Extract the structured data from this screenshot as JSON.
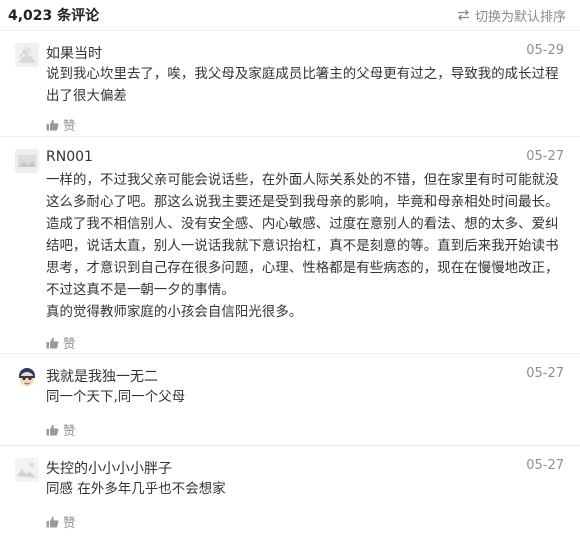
{
  "header": {
    "count_label": "4,023 条评论",
    "sort_label": "切换为默认排序"
  },
  "comments": [
    {
      "user": "如果当时",
      "date": "05-29",
      "lines": [
        "说到我心坎里去了，唉，我父母及家庭成员比箸主的父母更有过之，导致我的成长过程",
        "出了很大偏差"
      ],
      "like_label": "赞"
    },
    {
      "user": "RN001",
      "date": "05-27",
      "lines": [
        "一样的，不过我父亲可能会说话些，在外面人际关系处的不错，但在家里有时可能就没",
        "这么多耐心了吧。那这么说我主要还是受到我母亲的影响，毕竟和母亲相处时间最长。",
        "造成了我不相信别人、没有安全感、内心敏感、过度在意别人的看法、想的太多、爱纠",
        "结吧，说话太直，别人一说话我就下意识抬杠，真不是刻意的等。直到后来我开始读书",
        "思考，才意识到自己存在很多问题，心理、性格都是有些病态的，现在在慢慢地改正，",
        "不过这真不是一朝一夕的事情。",
        "真的觉得教师家庭的小孩会自信阳光很多。"
      ],
      "like_label": "赞"
    },
    {
      "user": "我就是我独一无二",
      "date": "05-27",
      "lines": [
        "同一个天下,同一个父母"
      ],
      "like_label": "赞"
    },
    {
      "user": "失控的小小小小胖子",
      "date": "05-27",
      "lines": [
        "同感 在外多年几乎也不会想家"
      ],
      "like_label": "赞"
    }
  ],
  "colors": {
    "text": "#333333",
    "meta": "#8f8f8f",
    "divider": "#ededed"
  },
  "icons": {
    "sort": "swap-arrows-icon",
    "like": "thumbs-up-icon"
  }
}
